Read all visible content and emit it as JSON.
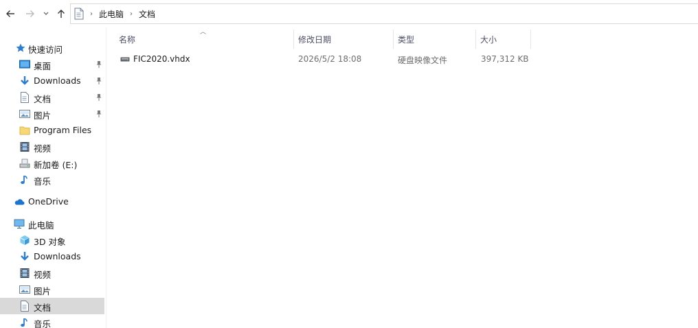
{
  "window": {
    "breadcrumb": [
      "此电脑",
      "文档"
    ]
  },
  "sidebar": {
    "quick_access": {
      "label": "快速访问",
      "items": [
        {
          "label": "桌面",
          "icon": "desktop-icon",
          "pinned": true
        },
        {
          "label": "Downloads",
          "icon": "download-arrow-icon",
          "pinned": true
        },
        {
          "label": "文档",
          "icon": "document-icon",
          "pinned": true
        },
        {
          "label": "图片",
          "icon": "pictures-icon",
          "pinned": true
        },
        {
          "label": "Program Files",
          "icon": "folder-icon",
          "pinned": false
        },
        {
          "label": "视频",
          "icon": "video-film-icon",
          "pinned": false
        },
        {
          "label": "新加卷 (E:)",
          "icon": "drive-icon",
          "pinned": false
        },
        {
          "label": "音乐",
          "icon": "music-note-icon",
          "pinned": false
        }
      ]
    },
    "onedrive": {
      "label": "OneDrive",
      "icon": "cloud-icon"
    },
    "this_pc": {
      "label": "此电脑",
      "items": [
        {
          "label": "3D 对象",
          "icon": "3d-cube-icon"
        },
        {
          "label": "Downloads",
          "icon": "download-arrow-icon"
        },
        {
          "label": "视频",
          "icon": "video-film-icon"
        },
        {
          "label": "图片",
          "icon": "pictures-icon"
        },
        {
          "label": "文档",
          "icon": "document-icon",
          "selected": true
        },
        {
          "label": "音乐",
          "icon": "music-note-icon"
        }
      ]
    }
  },
  "file_list": {
    "columns": {
      "name": "名称",
      "modified": "修改日期",
      "type": "类型",
      "size": "大小"
    },
    "rows": [
      {
        "name": "FIC2020.vhdx",
        "modified": "2026/5/2 18:08",
        "type": "硬盘映像文件",
        "size": "397,312 KB",
        "icon": "virtual-disk-icon"
      }
    ]
  },
  "colors": {
    "selected_bg": "#d9d9d9",
    "header_text": "#4d4d68",
    "accent_blue": "#2b7cd3"
  }
}
